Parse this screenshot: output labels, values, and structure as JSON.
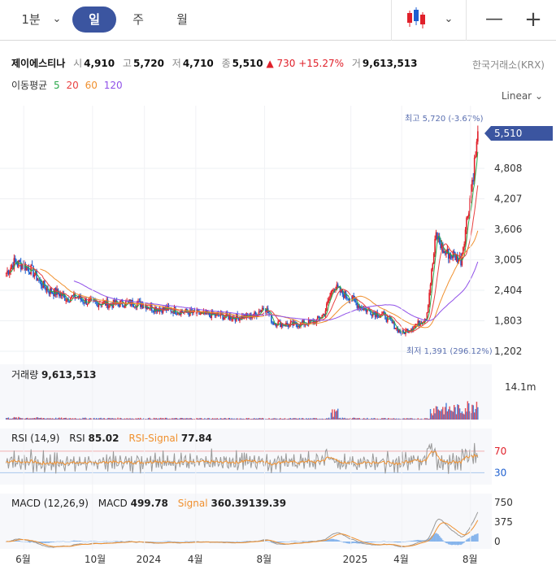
{
  "toolbar": {
    "interval": "1분",
    "tabs": [
      "일",
      "주",
      "월"
    ],
    "active_tab": "일"
  },
  "stock": {
    "name": "제이에스티나",
    "open_label": "시",
    "open": "4,910",
    "high_label": "고",
    "high": "5,720",
    "low_label": "저",
    "low": "4,710",
    "close_label": "종",
    "close": "5,510",
    "change": "▲ 730",
    "change_pct": "+15.27%",
    "volume_label": "거",
    "volume": "9,613,513",
    "exchange": "한국거래소(KRX)"
  },
  "ma": {
    "label": "이동평균",
    "periods": [
      "5",
      "20",
      "60",
      "120"
    ]
  },
  "scale_mode": "Linear",
  "colors": {
    "up": "#e0202a",
    "down": "#1d5fd0",
    "ma5": "#2aa84a",
    "ma20": "#e94040",
    "ma60": "#f0902e",
    "ma120": "#9050e8",
    "accent": "#3b55a0"
  },
  "chart_data": {
    "type": "candlestick",
    "price_axis_ticks": [
      "5,510",
      "4,808",
      "4,207",
      "3,606",
      "3,005",
      "2,404",
      "1,803",
      "1,202"
    ],
    "x_axis_ticks": [
      "6월",
      "10월",
      "2024",
      "4월",
      "8월",
      "2025",
      "4월",
      "8월"
    ],
    "current_price_label": "5,510",
    "max_label": "최고 5,720 (-3.67%)",
    "min_label": "최저 1,391 (296.12%)",
    "price_series": [
      [
        "2023-05-01",
        2750
      ],
      [
        "2023-05-15",
        2950
      ],
      [
        "2023-06-01",
        2900
      ],
      [
        "2023-06-15",
        2800
      ],
      [
        "2023-07-01",
        2550
      ],
      [
        "2023-07-15",
        2400
      ],
      [
        "2023-08-01",
        2350
      ],
      [
        "2023-08-15",
        2250
      ],
      [
        "2023-09-01",
        2280
      ],
      [
        "2023-09-15",
        2200
      ],
      [
        "2023-10-01",
        2150
      ],
      [
        "2023-10-15",
        2160
      ],
      [
        "2023-11-01",
        2130
      ],
      [
        "2023-11-15",
        2140
      ],
      [
        "2023-12-01",
        2160
      ],
      [
        "2023-12-15",
        2150
      ],
      [
        "2024-01-01",
        2120
      ],
      [
        "2024-01-15",
        2060
      ],
      [
        "2024-02-01",
        2040
      ],
      [
        "2024-02-15",
        2020
      ],
      [
        "2024-03-01",
        2000
      ],
      [
        "2024-03-15",
        1970
      ],
      [
        "2024-04-01",
        1950
      ],
      [
        "2024-04-15",
        1930
      ],
      [
        "2024-05-01",
        1920
      ],
      [
        "2024-05-15",
        1900
      ],
      [
        "2024-06-01",
        1880
      ],
      [
        "2024-06-15",
        1870
      ],
      [
        "2024-07-01",
        1890
      ],
      [
        "2024-07-15",
        1910
      ],
      [
        "2024-08-01",
        2100
      ],
      [
        "2024-08-15",
        1780
      ],
      [
        "2024-09-01",
        1740
      ],
      [
        "2024-09-15",
        1720
      ],
      [
        "2024-10-01",
        1740
      ],
      [
        "2024-10-15",
        1760
      ],
      [
        "2024-11-01",
        1800
      ],
      [
        "2024-11-15",
        1950
      ],
      [
        "2024-12-01",
        2500
      ],
      [
        "2024-12-15",
        2350
      ],
      [
        "2025-01-01",
        2250
      ],
      [
        "2025-01-15",
        2100
      ],
      [
        "2025-02-01",
        2000
      ],
      [
        "2025-02-15",
        1950
      ],
      [
        "2025-03-01",
        1900
      ],
      [
        "2025-03-15",
        1750
      ],
      [
        "2025-04-01",
        1550
      ],
      [
        "2025-04-15",
        1650
      ],
      [
        "2025-05-01",
        1750
      ],
      [
        "2025-05-15",
        1900
      ],
      [
        "2025-06-01",
        3500
      ],
      [
        "2025-06-15",
        3150
      ],
      [
        "2025-07-01",
        3100
      ],
      [
        "2025-07-15",
        3000
      ],
      [
        "2025-08-01",
        4300
      ],
      [
        "2025-08-15",
        5510
      ]
    ],
    "volume_panel": {
      "label": "거래량",
      "value": "9,613,513",
      "axis": "14.1m"
    },
    "rsi_panel": {
      "label": "RSI (14,9)",
      "rsi_label": "RSI",
      "rsi": "85.02",
      "signal_label": "RSI-Signal",
      "signal": "77.84",
      "levels": [
        "70",
        "30"
      ]
    },
    "macd_panel": {
      "label": "MACD (12,26,9)",
      "macd_label": "MACD",
      "macd": "499.78",
      "signal_label": "Signal",
      "signal": "360.39139.39",
      "axis": [
        "750",
        "375",
        "0"
      ]
    }
  }
}
